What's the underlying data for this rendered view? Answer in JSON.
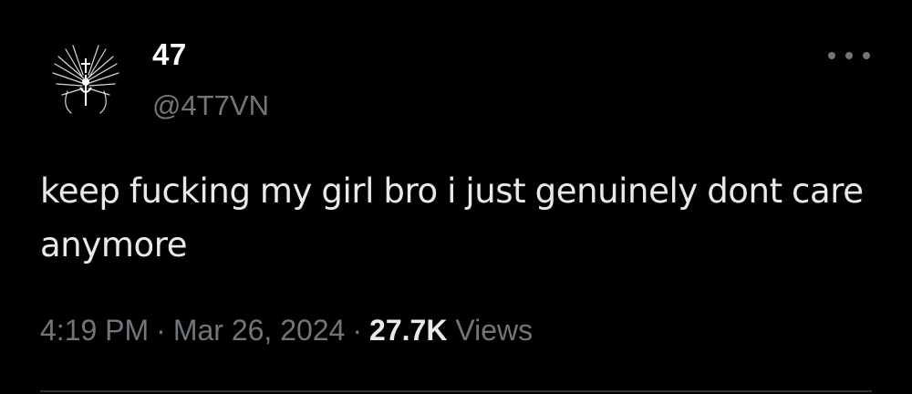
{
  "colors": {
    "background": "#000000",
    "primary_text": "#e7e9ea",
    "secondary_text": "#71767b",
    "divider": "#2f3336"
  },
  "author": {
    "avatar_icon": "winged-cross-emblem-icon",
    "display_name": "47",
    "handle": "@4T7VN"
  },
  "more_menu": {
    "icon": "more-dots-icon"
  },
  "tweet": {
    "text": "keep fucking my girl bro i just genuinely dont care anymore"
  },
  "meta": {
    "time": "4:19 PM",
    "separator": "·",
    "date": "Mar 26, 2024",
    "views_count": "27.7K",
    "views_label": "Views"
  }
}
